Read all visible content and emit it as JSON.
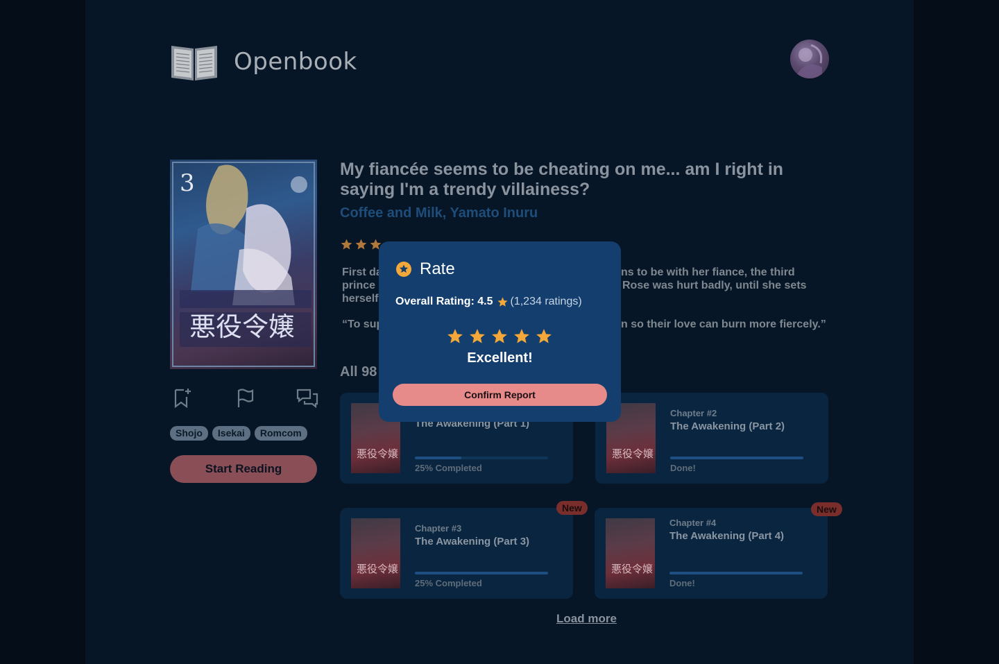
{
  "app": {
    "name": "Openbook"
  },
  "icons": {
    "logo": "open-book-icon",
    "avatar": "user-avatar",
    "bookmark": "bookmark-add-icon",
    "report": "flag-icon",
    "comments": "comments-icon",
    "star": "star-icon",
    "rate": "star-circle-icon"
  },
  "book": {
    "title": "My fiancée seems to be cheating on me... am I right in saying I'm a trendy villainess?",
    "authors": "Coffee and Milk, Yamato Inuru",
    "cover_title": "悪役令嬢",
    "cover_number": "3",
    "description_left": "First da",
    "description_left_2": "prince",
    "description_left_3": "herself",
    "description_right": "ns to be with her fiance, the third",
    "description_right_2": "Rose was hurt badly, until she sets",
    "quote_left": "“To sup",
    "quote_right": "n so their love can burn more fiercely.”",
    "tags": [
      "Shojo",
      "Isekai",
      "Romcom"
    ],
    "start_label": "Start Reading",
    "chapters_heading": "All 98"
  },
  "chapters": [
    {
      "number": "",
      "title": "The Awakening (Part 1)",
      "progress_label": "25% Completed",
      "progress": 0.35,
      "new": false
    },
    {
      "number": "Chapter #2",
      "title": "The Awakening (Part 2)",
      "progress_label": "Done!",
      "progress": 1.0,
      "new": false
    },
    {
      "number": "Chapter #3",
      "title": "The Awakening (Part 3)",
      "progress_label": "25% Completed",
      "progress": 1.0,
      "new": true,
      "badge": "New"
    },
    {
      "number": "Chapter #4",
      "title": "The Awakening (Part 4)",
      "progress_label": "Done!",
      "progress": 1.0,
      "new": true,
      "badge": "New"
    }
  ],
  "load_more": "Load more",
  "modal": {
    "title": "Rate",
    "overall_label": "Overall Rating: 4.5",
    "ratings_count": "(1,234 ratings)",
    "stars_selected": 5,
    "verdict": "Excellent!",
    "confirm_label": "Confirm Report"
  },
  "colors": {
    "accent": "#e68a8a",
    "star": "#f5a83a",
    "modal_bg": "#143e6e"
  }
}
